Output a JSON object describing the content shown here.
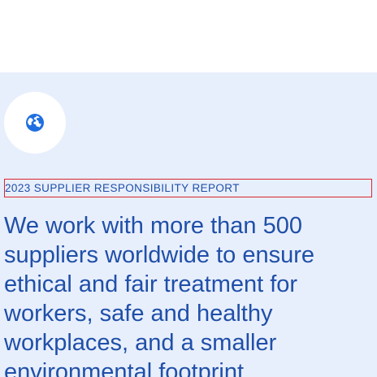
{
  "hero": {
    "icon": "globe-icon",
    "kicker": "2023 SUPPLIER RESPONSIBILITY REPORT",
    "headline": "We work with more than 500 suppliers worldwide to ensure ethical and fair treatment for workers, safe and healthy workplaces, and a smaller environmental footprint"
  },
  "colors": {
    "panel_background": "#e8effc",
    "accent_blue": "#1f4fa8",
    "focus_outline": "#d9252f"
  }
}
